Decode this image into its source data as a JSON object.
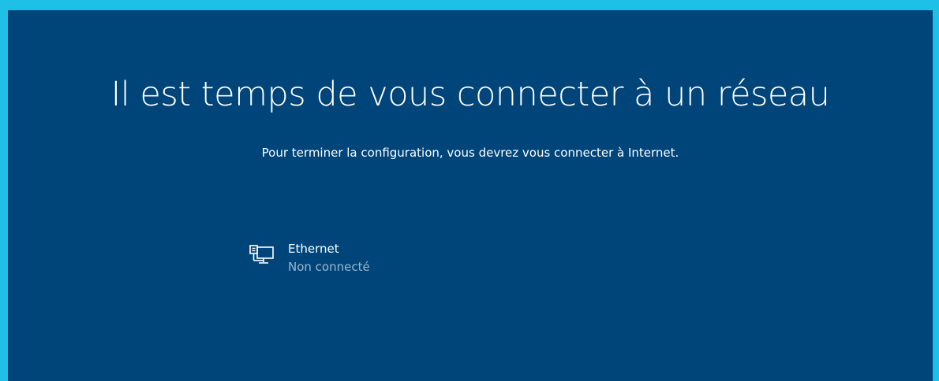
{
  "page": {
    "title": "Il est temps de vous connecter à un réseau",
    "subtitle": "Pour terminer la configuration, vous devrez vous connecter à Internet."
  },
  "network": {
    "icon": "ethernet-computer-icon",
    "name": "Ethernet",
    "status": "Non connecté"
  },
  "colors": {
    "outer_border": "#1fc0e8",
    "background": "#00457a",
    "text": "#ffffff",
    "secondary_text": "#9bb7d0"
  }
}
